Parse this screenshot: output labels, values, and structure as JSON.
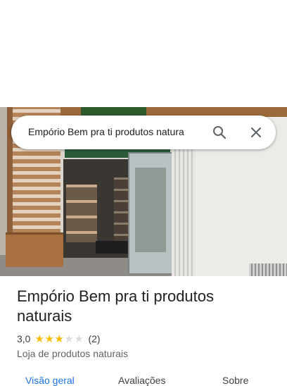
{
  "search": {
    "value": "Empório Bem pra ti produtos natura"
  },
  "place": {
    "title": "Empório Bem pra ti produtos naturais",
    "rating": "3,0",
    "stars_filled": 3,
    "stars_total": 5,
    "review_count": "(2)",
    "category": "Loja de produtos naturais"
  },
  "tabs": [
    {
      "label": "Visão geral",
      "active": true
    },
    {
      "label": "Avaliações",
      "active": false
    },
    {
      "label": "Sobre",
      "active": false
    }
  ],
  "colors": {
    "accent": "#1a73e8",
    "star": "#fbbc04",
    "text_primary": "#202124",
    "text_secondary": "#5f6368"
  },
  "icons": [
    "search-icon",
    "close-icon",
    "star-icon"
  ]
}
